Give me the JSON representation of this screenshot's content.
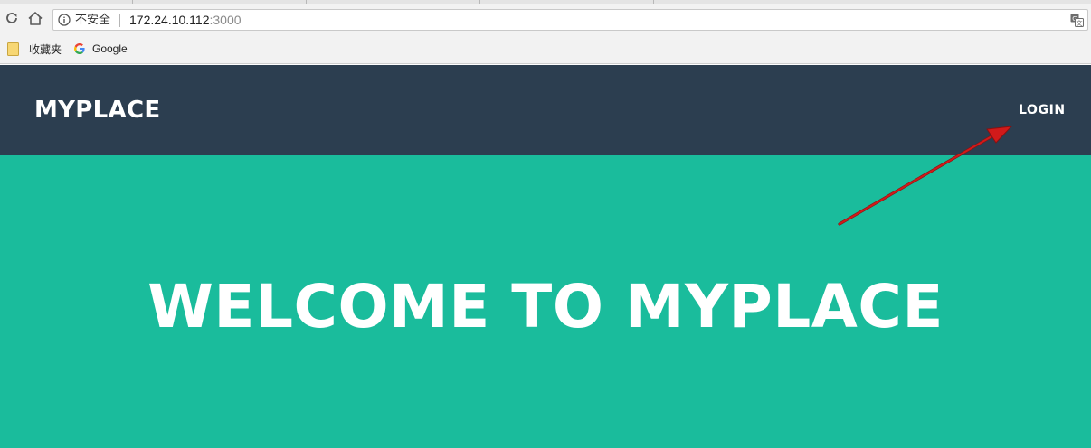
{
  "browser": {
    "security_label": "不安全",
    "url_host": "172.24.10.112",
    "url_port": ":3000",
    "bookmarks": [
      {
        "label": "收藏夹",
        "icon": "folder-icon"
      },
      {
        "label": "Google",
        "icon": "google-icon"
      }
    ],
    "icons": [
      "reload-icon",
      "home-icon",
      "info-icon",
      "translate-icon"
    ]
  },
  "site": {
    "brand": "MYPLACE",
    "nav_login": "LOGIN",
    "hero_title": "WELCOME TO MYPLACE"
  },
  "colors": {
    "navbar": "#2c3e50",
    "hero": "#1abc9c",
    "text": "#ffffff",
    "annotation_arrow": "#d11a1a"
  }
}
